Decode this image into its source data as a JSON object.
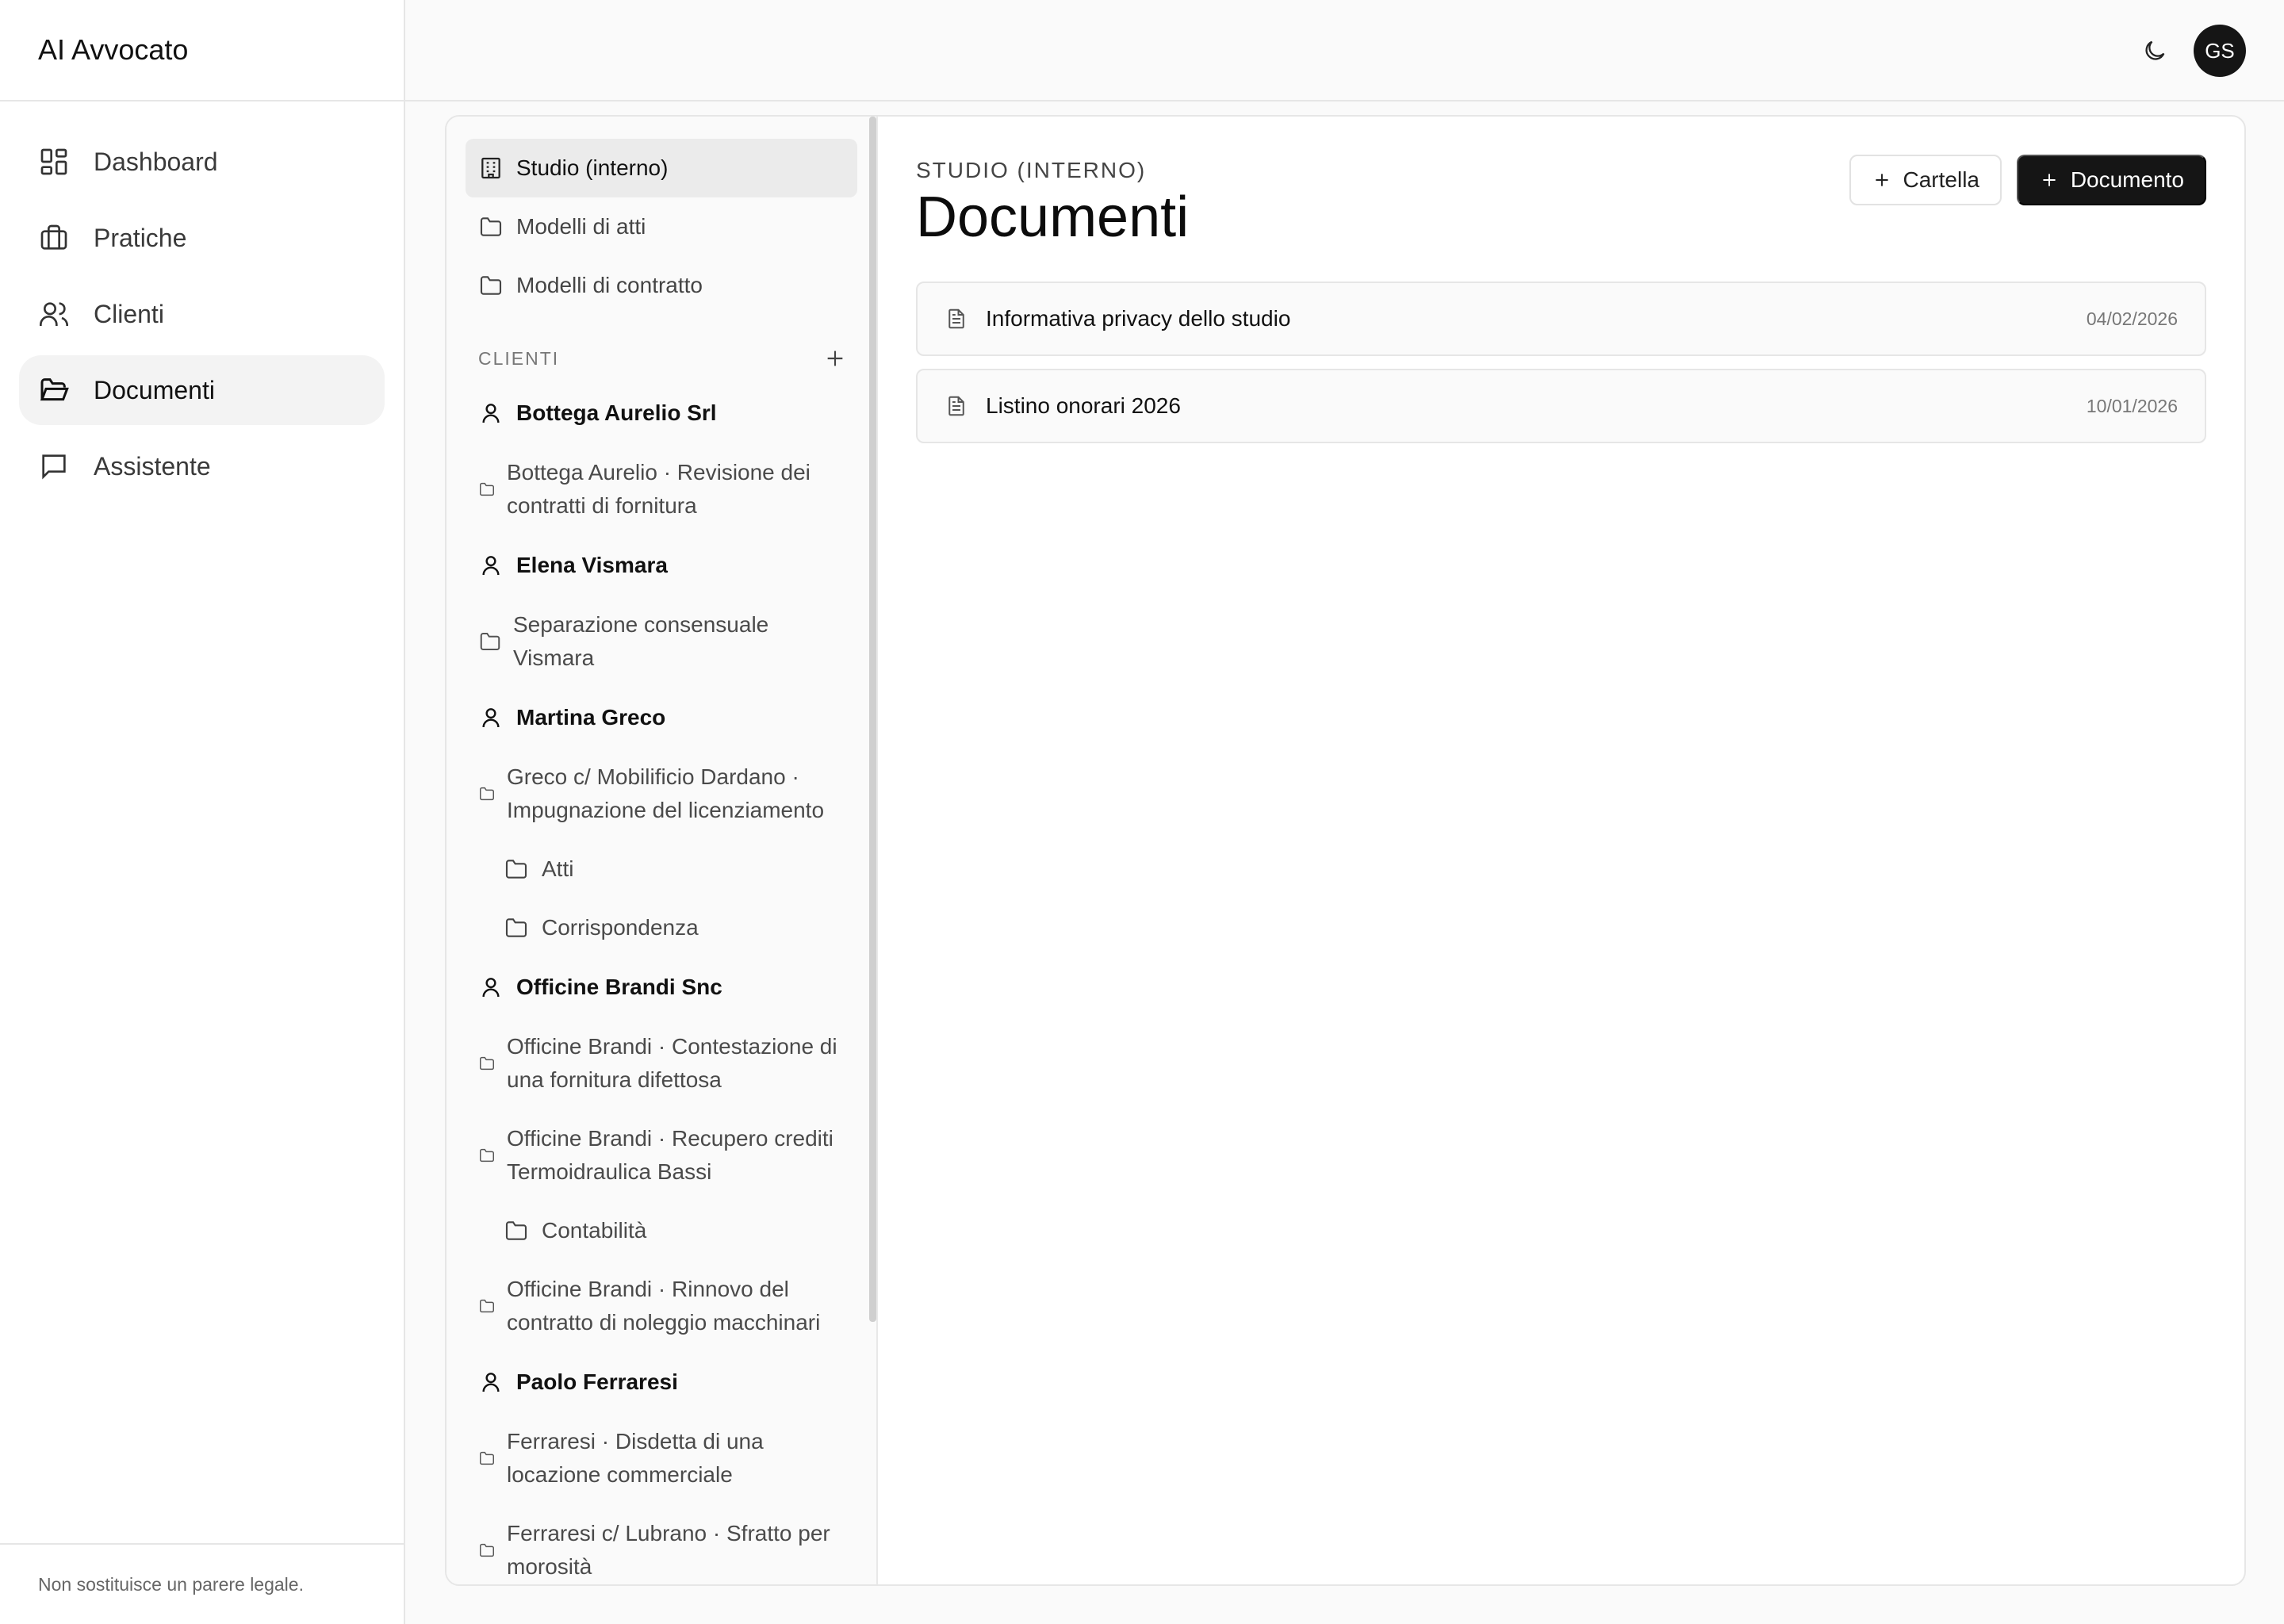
{
  "app": {
    "name": "AI Avvocato"
  },
  "nav": {
    "items": [
      {
        "label": "Dashboard",
        "icon": "dashboard-icon",
        "active": false
      },
      {
        "label": "Pratiche",
        "icon": "briefcase-icon",
        "active": false
      },
      {
        "label": "Clienti",
        "icon": "users-icon",
        "active": false
      },
      {
        "label": "Documenti",
        "icon": "folder-open-icon",
        "active": true
      },
      {
        "label": "Assistente",
        "icon": "chat-icon",
        "active": false
      }
    ]
  },
  "footer": {
    "disclaimer": "Non sostituisce un parere legale."
  },
  "topbar": {
    "avatar_initials": "GS"
  },
  "tree": {
    "top_items": [
      {
        "label": "Studio (interno)",
        "icon": "building-icon",
        "active": true
      },
      {
        "label": "Modelli di atti",
        "icon": "folder-icon"
      },
      {
        "label": "Modelli di contratto",
        "icon": "folder-icon"
      }
    ],
    "clients_heading": "CLIENTI",
    "clients": [
      {
        "name": "Bottega Aurelio Srl",
        "matters": [
          {
            "label": "Bottega Aurelio · Revisione dei contratti di fornitura",
            "subfolders": []
          }
        ]
      },
      {
        "name": "Elena Vismara",
        "matters": [
          {
            "label": "Separazione consensuale Vismara",
            "subfolders": []
          }
        ]
      },
      {
        "name": "Martina Greco",
        "matters": [
          {
            "label": "Greco c/ Mobilificio Dardano · Impugnazione del licenziamento",
            "subfolders": [
              "Atti",
              "Corrispondenza"
            ]
          }
        ]
      },
      {
        "name": "Officine Brandi Snc",
        "matters": [
          {
            "label": "Officine Brandi · Contestazione di una fornitura difettosa",
            "subfolders": []
          },
          {
            "label": "Officine Brandi · Recupero crediti Termoidraulica Bassi",
            "subfolders": [
              "Contabilità"
            ]
          },
          {
            "label": "Officine Brandi · Rinnovo del contratto di noleggio macchinari",
            "subfolders": []
          }
        ]
      },
      {
        "name": "Paolo Ferraresi",
        "matters": [
          {
            "label": "Ferraresi · Disdetta di una locazione commerciale",
            "subfolders": []
          },
          {
            "label": "Ferraresi c/ Lubrano · Sfratto per morosità",
            "subfolders": []
          }
        ]
      }
    ]
  },
  "content": {
    "eyebrow": "STUDIO (INTERNO)",
    "title": "Documenti",
    "buttons": {
      "new_folder": "Cartella",
      "new_document": "Documento"
    },
    "documents": [
      {
        "name": "Informativa privacy dello studio",
        "date": "04/02/2026"
      },
      {
        "name": "Listino onorari 2026",
        "date": "10/01/2026"
      }
    ]
  }
}
